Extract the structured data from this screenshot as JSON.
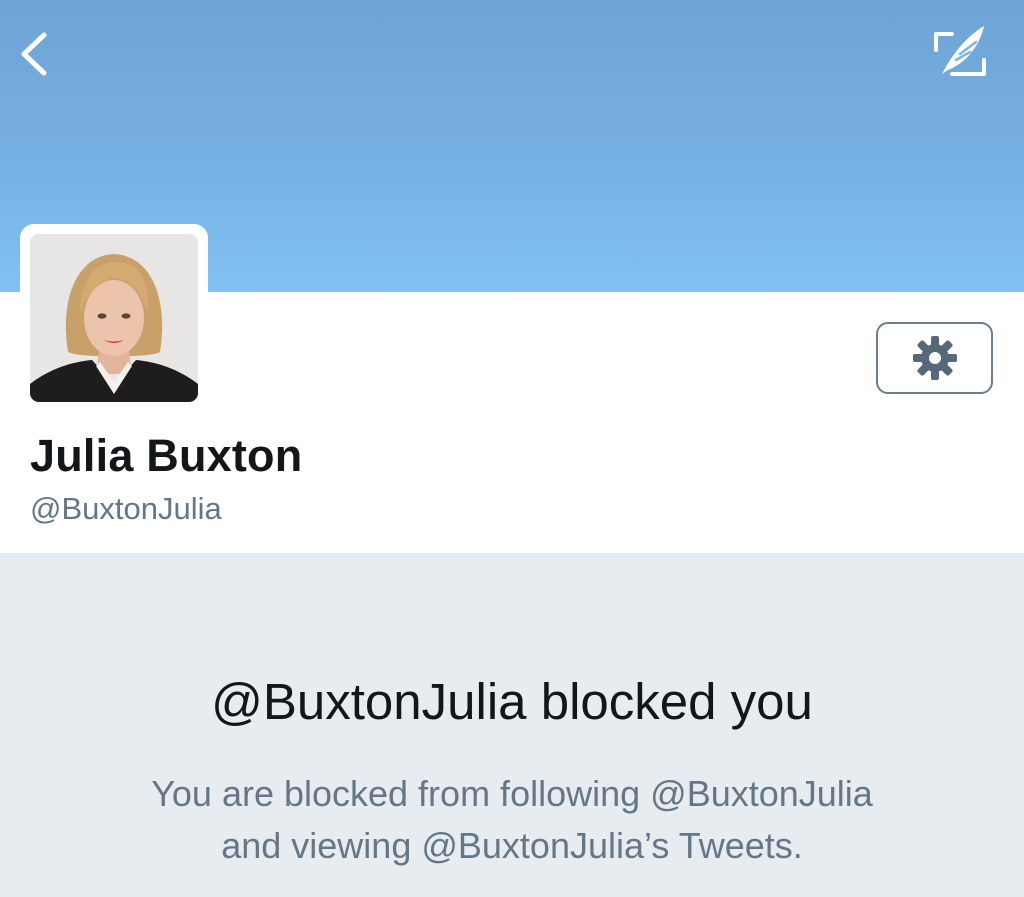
{
  "header": {
    "back_icon": "chevron-left-icon",
    "compose_icon": "compose-quill-icon",
    "banner_colors": [
      "#6ea4d4",
      "#82c1f3"
    ]
  },
  "profile": {
    "display_name": "Julia Buxton",
    "handle": "@BuxtonJulia",
    "avatar": "profile-photo",
    "settings_icon": "gear-icon"
  },
  "blocked": {
    "title": "@BuxtonJulia blocked you",
    "description_line1": "You are blocked from following @BuxtonJulia",
    "description_line2": "and viewing @BuxtonJulia’s Tweets."
  },
  "colors": {
    "primary_text": "#14171a",
    "secondary_text": "#657786",
    "blocked_background": "#e6ecf0",
    "button_border": "#6b7d8e"
  }
}
